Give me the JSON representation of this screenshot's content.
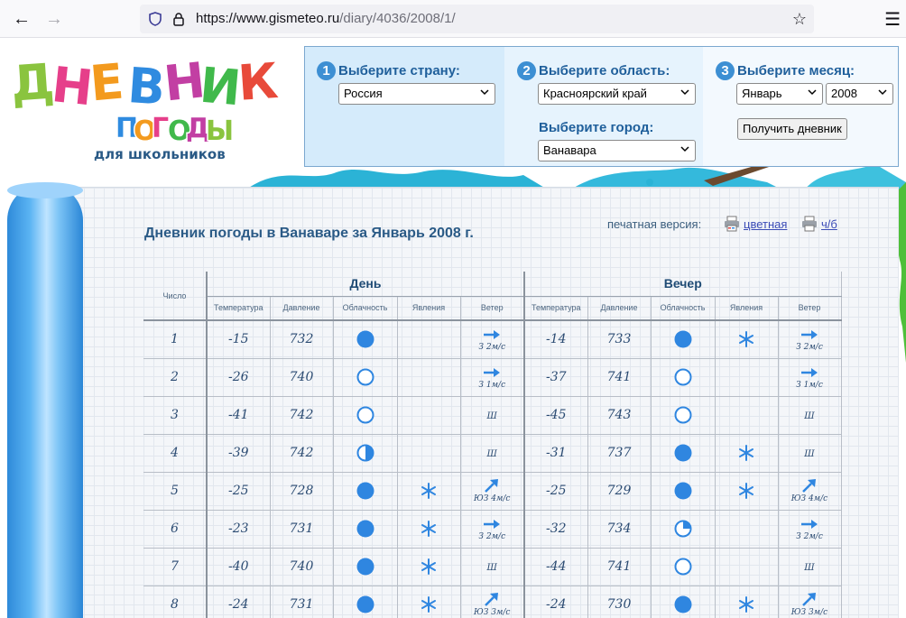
{
  "browser": {
    "url_main": "https://www.gismeteo.ru",
    "url_path": "/diary/4036/2008/1/"
  },
  "logo": {
    "line1": "ДНЕВНИК",
    "line2": "ПОГОДЫ",
    "line3": "для школьников"
  },
  "selector": {
    "step1": {
      "num": "1",
      "label": "Выберите страну:",
      "value": "Россия"
    },
    "step2": {
      "num": "2",
      "label": "Выберите область:",
      "value": "Красноярский край",
      "city_label": "Выберите город:",
      "city_value": "Ванавара"
    },
    "step3": {
      "num": "3",
      "label": "Выберите месяц:",
      "month": "Январь",
      "year": "2008",
      "button": "Получить дневник"
    }
  },
  "diary": {
    "title": "Дневник погоды в Ванаваре за Январь 2008 г.",
    "print_label": "печатная версия:",
    "print_color": "цветная",
    "print_bw": "ч/б",
    "col_number": "Число",
    "group_day": "День",
    "group_evening": "Вечер",
    "sub_headers": [
      "Температура",
      "Давление",
      "Облачность",
      "Явления",
      "Ветер"
    ],
    "rows": [
      {
        "day": "1",
        "d": {
          "t": "-15",
          "p": "732",
          "cloud": "full",
          "snow": false,
          "wind": {
            "dir": "east",
            "label": "З 2м/с"
          }
        },
        "e": {
          "t": "-14",
          "p": "733",
          "cloud": "full",
          "snow": true,
          "wind": {
            "dir": "east",
            "label": "З 2м/с"
          }
        }
      },
      {
        "day": "2",
        "d": {
          "t": "-26",
          "p": "740",
          "cloud": "clear",
          "snow": false,
          "wind": {
            "dir": "east",
            "label": "З 1м/с"
          }
        },
        "e": {
          "t": "-37",
          "p": "741",
          "cloud": "clear",
          "snow": false,
          "wind": {
            "dir": "east",
            "label": "З 1м/с"
          }
        }
      },
      {
        "day": "3",
        "d": {
          "t": "-41",
          "p": "742",
          "cloud": "clear",
          "snow": false,
          "wind": {
            "dir": "calm",
            "label": "Ш"
          }
        },
        "e": {
          "t": "-45",
          "p": "743",
          "cloud": "clear",
          "snow": false,
          "wind": {
            "dir": "calm",
            "label": "Ш"
          }
        }
      },
      {
        "day": "4",
        "d": {
          "t": "-39",
          "p": "742",
          "cloud": "half",
          "snow": false,
          "wind": {
            "dir": "calm",
            "label": "Ш"
          }
        },
        "e": {
          "t": "-31",
          "p": "737",
          "cloud": "full",
          "snow": true,
          "wind": {
            "dir": "calm",
            "label": "Ш"
          }
        }
      },
      {
        "day": "5",
        "d": {
          "t": "-25",
          "p": "728",
          "cloud": "full",
          "snow": true,
          "wind": {
            "dir": "northeast",
            "label": "ЮЗ 4м/с"
          }
        },
        "e": {
          "t": "-25",
          "p": "729",
          "cloud": "full",
          "snow": true,
          "wind": {
            "dir": "northeast",
            "label": "ЮЗ 4м/с"
          }
        }
      },
      {
        "day": "6",
        "d": {
          "t": "-23",
          "p": "731",
          "cloud": "full",
          "snow": true,
          "wind": {
            "dir": "east",
            "label": "З 2м/с"
          }
        },
        "e": {
          "t": "-32",
          "p": "734",
          "cloud": "quarter",
          "snow": false,
          "wind": {
            "dir": "east",
            "label": "З 2м/с"
          }
        }
      },
      {
        "day": "7",
        "d": {
          "t": "-40",
          "p": "740",
          "cloud": "full",
          "snow": true,
          "wind": {
            "dir": "calm",
            "label": "Ш"
          }
        },
        "e": {
          "t": "-44",
          "p": "741",
          "cloud": "clear",
          "snow": false,
          "wind": {
            "dir": "calm",
            "label": "Ш"
          }
        }
      },
      {
        "day": "8",
        "d": {
          "t": "-24",
          "p": "731",
          "cloud": "full",
          "snow": true,
          "wind": {
            "dir": "northeast",
            "label": "ЮЗ 3м/с"
          }
        },
        "e": {
          "t": "-24",
          "p": "730",
          "cloud": "full",
          "snow": true,
          "wind": {
            "dir": "northeast",
            "label": "ЮЗ 3м/с"
          }
        }
      }
    ]
  },
  "colors": {
    "accent": "#3d8fd3",
    "cloud_fill": "#2f86e0",
    "text": "#2b4b72"
  }
}
